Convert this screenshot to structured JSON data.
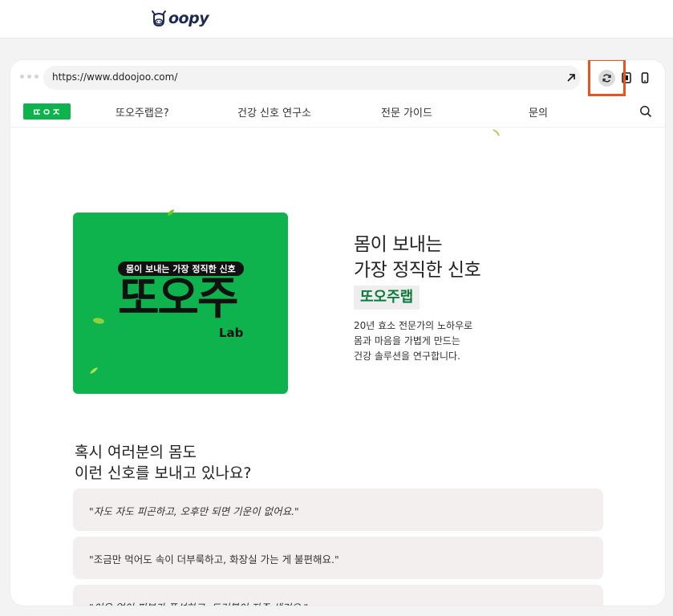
{
  "app": {
    "logo_text": "oopy"
  },
  "browser": {
    "url": "https://www.ddoojoo.com/",
    "icons": [
      "more-dots-icon",
      "external-link-icon",
      "refresh-icon",
      "tablet-icon",
      "phone-icon"
    ],
    "accent_highlight_color": "#e8541e"
  },
  "site_nav": {
    "brand": "ㄸㅇㅈ",
    "items": [
      {
        "label": "또오주랩은?"
      },
      {
        "label": "건강 신호 연구소"
      },
      {
        "label": "전문 가이드"
      },
      {
        "label": "문의"
      }
    ],
    "search_icon": "search-icon"
  },
  "hero": {
    "card_pill": "몸이 보내는 가장 정직한 신호",
    "card_title": "또오주",
    "card_sub": "Lab",
    "headline_line1": "몸이 보내는",
    "headline_line2": "가장 정직한 신호",
    "name_tag": "또오주랩",
    "desc_line1": "20년 효소 전문가의 노하우로",
    "desc_line2": "몸과 마음을 가볍게 만드는",
    "desc_line3": "건강 솔루션을 연구합니다.",
    "brand_green": "#0fb34d"
  },
  "signals": {
    "question_line1": "혹시 여러분의 몸도",
    "question_line2": "이런 신호를 보내고 있나요?",
    "quotes": [
      {
        "text": "\"자도 자도 피곤하고, 오후만 되면 기운이 없어요.\""
      },
      {
        "text": "\"조금만 먹어도 속이 더부룩하고, 화장실 가는 게 불편해요.\""
      },
      {
        "text": "\"이유 없이 피부가 푸석하고, 트러블이 자주 생겨요.\""
      }
    ]
  }
}
